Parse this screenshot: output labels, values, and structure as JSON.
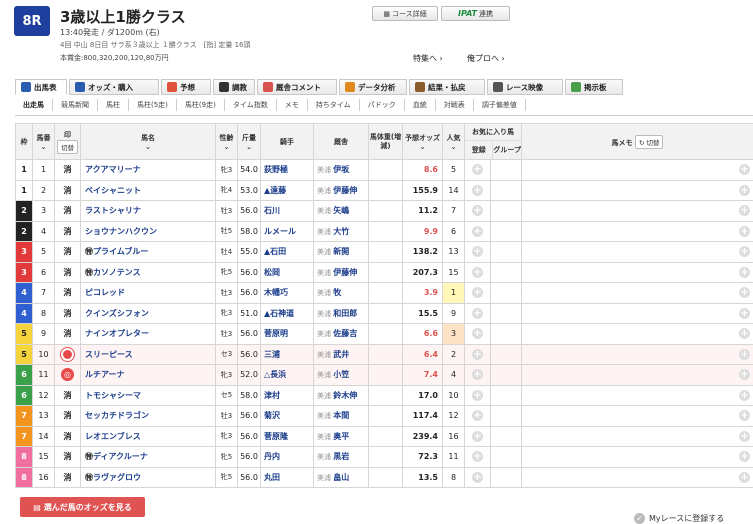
{
  "race": {
    "number": "8R",
    "title": "3歳以上1勝クラス",
    "info1": "13:40発走 / ダ1200m (右)",
    "info2": "4回 中山 8日目 サラ系３歳以上 １勝クラス　[指] 定量 16頭",
    "info3": "本賞金:800,320,200,120,80万円"
  },
  "header_buttons": {
    "course": "コース詳細",
    "ipat_logo": "IPAT",
    "ipat_label": "連携"
  },
  "links": {
    "special": "特集へ",
    "prediction": "俺プロへ"
  },
  "tabs": [
    {
      "label": "出馬表",
      "color": "#2a5db0"
    },
    {
      "label": "オッズ・購入",
      "color": "#2a5db0"
    },
    {
      "label": "予想",
      "color": "#e0533a"
    },
    {
      "label": "調教",
      "color": "#333333"
    },
    {
      "label": "厩舎コメント",
      "color": "#d9534f"
    },
    {
      "label": "データ分析",
      "color": "#e08a1e"
    },
    {
      "label": "結果・払戻",
      "color": "#8a5a2a"
    },
    {
      "label": "レース映像",
      "color": "#555555"
    },
    {
      "label": "掲示板",
      "color": "#4aa04a"
    }
  ],
  "subtabs": [
    "出走馬",
    "競馬新聞",
    "馬柱",
    "馬柱(5走)",
    "馬柱(9走)",
    "タイム指数",
    "メモ",
    "持ちタイム",
    "パドック",
    "血統",
    "対戦表",
    "調子偏差値"
  ],
  "table": {
    "headers": {
      "waku": "枠",
      "umaban": "馬番",
      "mark": "印",
      "mark_toggle": "切替",
      "horse": "馬名",
      "sexage": "性齢",
      "weight": "斤量",
      "jockey": "騎手",
      "trainer": "厩舎",
      "bodyweight": "馬体重(増減)",
      "odds": "予想オッズ",
      "popular": "人気",
      "fav": "お気に入り馬",
      "fav_reg": "登録",
      "fav_group": "グループ",
      "memo": "馬メモ",
      "memo_toggle": "切替"
    },
    "region": "美浦",
    "rows": [
      {
        "waku": "1",
        "umaban": "1",
        "mark": "消",
        "horse": "アクアマリーナ",
        "sexage": "牝3",
        "weight": "54.0",
        "jockey": "荻野極",
        "trainer": "伊坂",
        "odds": "8.6",
        "popular": "5"
      },
      {
        "waku": "1",
        "umaban": "2",
        "mark": "消",
        "horse": "ベイシャニット",
        "sexage": "牝4",
        "weight": "53.0",
        "jockey": "▲遠藤",
        "trainer": "伊藤伸",
        "odds": "155.9",
        "popular": "14"
      },
      {
        "waku": "2",
        "umaban": "3",
        "mark": "消",
        "horse": "ラストシャリナ",
        "sexage": "牡3",
        "weight": "56.0",
        "jockey": "石川",
        "trainer": "矢嶋",
        "odds": "11.2",
        "popular": "7"
      },
      {
        "waku": "2",
        "umaban": "4",
        "mark": "消",
        "horse": "ショウナンハクウン",
        "sexage": "牡5",
        "weight": "58.0",
        "jockey": "ルメール",
        "trainer": "大竹",
        "odds": "9.9",
        "popular": "6"
      },
      {
        "waku": "3",
        "umaban": "5",
        "mark": "消",
        "horse": "プライムブルー",
        "sexage": "牡4",
        "weight": "55.0",
        "jockey": "▲石田",
        "trainer": "新開",
        "odds": "138.2",
        "popular": "13",
        "maru": true
      },
      {
        "waku": "3",
        "umaban": "6",
        "mark": "消",
        "horse": "カソノテンス",
        "sexage": "牝5",
        "weight": "56.0",
        "jockey": "松岡",
        "trainer": "伊藤伸",
        "odds": "207.3",
        "popular": "15",
        "maru": true
      },
      {
        "waku": "4",
        "umaban": "7",
        "mark": "消",
        "horse": "ピコレッド",
        "sexage": "牡3",
        "weight": "56.0",
        "jockey": "木幡巧",
        "trainer": "牧",
        "odds": "3.9",
        "popular": "1"
      },
      {
        "waku": "4",
        "umaban": "8",
        "mark": "消",
        "horse": "クインズシフォン",
        "sexage": "牝3",
        "weight": "51.0",
        "jockey": "▲石神道",
        "trainer": "和田郎",
        "odds": "15.5",
        "popular": "9"
      },
      {
        "waku": "5",
        "umaban": "9",
        "mark": "消",
        "horse": "ナインオプレター",
        "sexage": "牡3",
        "weight": "56.0",
        "jockey": "菅原明",
        "trainer": "佐藤吉",
        "odds": "6.6",
        "popular": "3"
      },
      {
        "waku": "5",
        "umaban": "10",
        "mark": "◯",
        "horse": "スリーピース",
        "sexage": "セ3",
        "weight": "56.0",
        "jockey": "三浦",
        "trainer": "武井",
        "odds": "6.4",
        "popular": "2",
        "hl": true
      },
      {
        "waku": "6",
        "umaban": "11",
        "mark": "◎",
        "horse": "ルチアーナ",
        "sexage": "牝3",
        "weight": "52.0",
        "jockey": "△長浜",
        "trainer": "小笠",
        "odds": "7.4",
        "popular": "4",
        "hl": true
      },
      {
        "waku": "6",
        "umaban": "12",
        "mark": "消",
        "horse": "トモシャシーマ",
        "sexage": "セ5",
        "weight": "58.0",
        "jockey": "津村",
        "trainer": "鈴木伸",
        "odds": "17.0",
        "popular": "10"
      },
      {
        "waku": "7",
        "umaban": "13",
        "mark": "消",
        "horse": "セッカチドラゴン",
        "sexage": "牡3",
        "weight": "56.0",
        "jockey": "菊沢",
        "trainer": "本間",
        "odds": "117.4",
        "popular": "12"
      },
      {
        "waku": "7",
        "umaban": "14",
        "mark": "消",
        "horse": "レオエンブレス",
        "sexage": "牝3",
        "weight": "56.0",
        "jockey": "菅原隆",
        "trainer": "奥平",
        "odds": "239.4",
        "popular": "16"
      },
      {
        "waku": "8",
        "umaban": "15",
        "mark": "消",
        "horse": "ディアクルーナ",
        "sexage": "牝5",
        "weight": "56.0",
        "jockey": "丹内",
        "trainer": "黒岩",
        "odds": "72.3",
        "popular": "11",
        "maru": true
      },
      {
        "waku": "8",
        "umaban": "16",
        "mark": "消",
        "horse": "ラヴァグロウ",
        "sexage": "牝5",
        "weight": "56.0",
        "jockey": "丸田",
        "trainer": "畠山",
        "odds": "13.5",
        "popular": "8",
        "maru": true
      }
    ]
  },
  "footer": {
    "odds_button": "選んだ馬のオッズを見る",
    "myrace": "Myレースに登録する"
  },
  "colors": {
    "waku": {
      "1": "#ffffff",
      "2": "#222222",
      "3": "#e23a3a",
      "4": "#2f5fd0",
      "5": "#f5d33a",
      "6": "#3aa04a",
      "7": "#f3941e",
      "8": "#f06fa0"
    },
    "accent": "#1e3f9e",
    "hot_odds": "#d9534f"
  }
}
